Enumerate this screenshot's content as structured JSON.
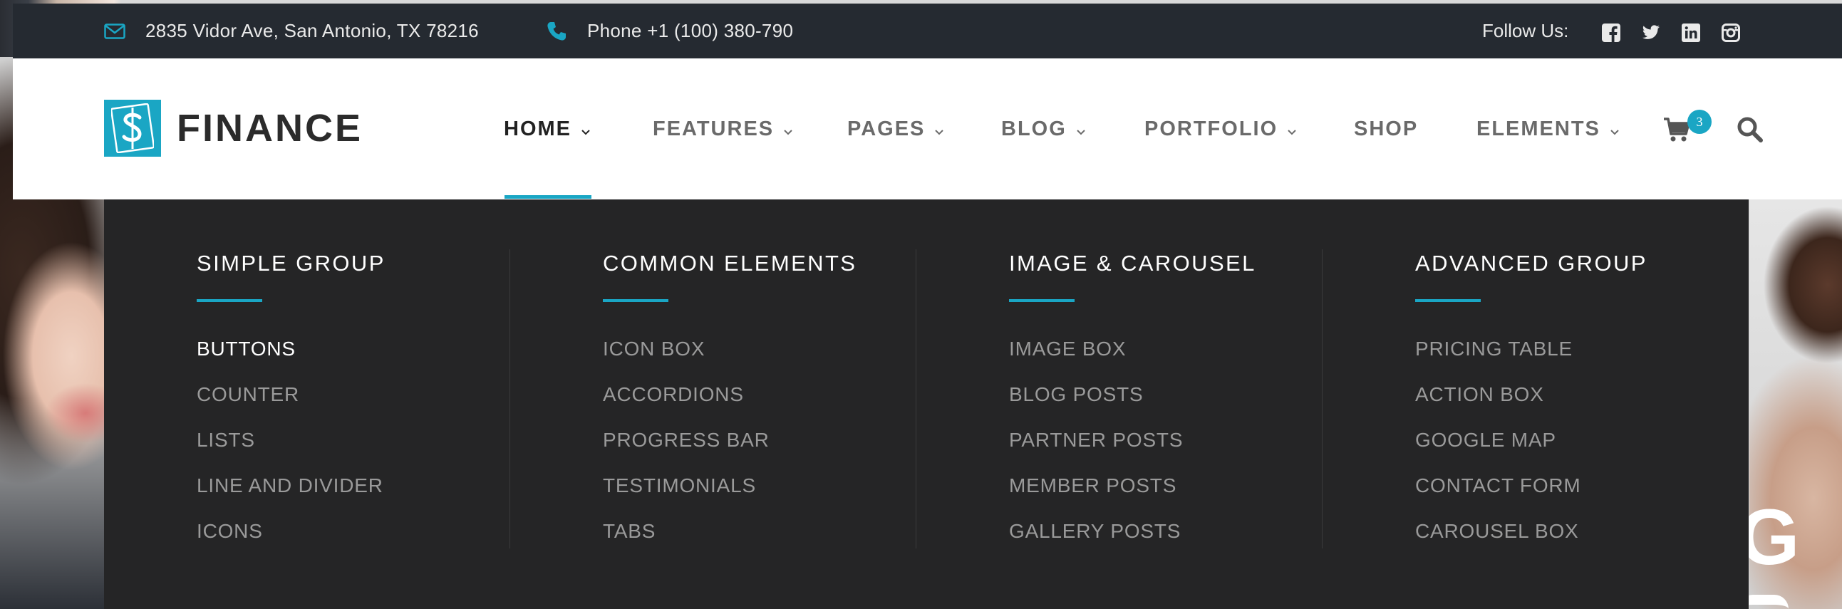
{
  "colors": {
    "accent": "#1aa6c4",
    "topbar_bg": "#252a31",
    "mega_bg": "#252526",
    "text_dark": "#2b2b2b",
    "nav_text": "#6a6a6a"
  },
  "topbar": {
    "address": "2835 Vidor Ave, San Antonio, TX 78216",
    "phone": "Phone +1 (100) 380-790",
    "follow_label": "Follow Us:",
    "social_icons": [
      "facebook-icon",
      "twitter-icon",
      "linkedin-icon",
      "instagram-icon"
    ]
  },
  "header": {
    "logo_text": "FINANCE",
    "logo_icon": "dollar-icon",
    "nav": [
      {
        "label": "HOME",
        "has_dropdown": true,
        "active": true
      },
      {
        "label": "FEATURES",
        "has_dropdown": true
      },
      {
        "label": "PAGES",
        "has_dropdown": true
      },
      {
        "label": "BLOG",
        "has_dropdown": true
      },
      {
        "label": "PORTFOLIO",
        "has_dropdown": true
      },
      {
        "label": "SHOP",
        "has_dropdown": false
      },
      {
        "label": "ELEMENTS",
        "has_dropdown": true
      }
    ],
    "cart_count": "3"
  },
  "mega_menu": {
    "columns": [
      {
        "title": "SIMPLE GROUP",
        "items": [
          "BUTTONS",
          "COUNTER",
          "LISTS",
          "LINE AND DIVIDER",
          "ICONS"
        ],
        "active_item": "BUTTONS"
      },
      {
        "title": "COMMON ELEMENTS",
        "items": [
          "ICON BOX",
          "ACCORDIONS",
          "PROGRESS BAR",
          "TESTIMONIALS",
          "TABS"
        ]
      },
      {
        "title": "IMAGE & CAROUSEL",
        "items": [
          "IMAGE BOX",
          "BLOG POSTS",
          "PARTNER POSTS",
          "MEMBER POSTS",
          "GALLERY POSTS"
        ]
      },
      {
        "title": "ADVANCED GROUP",
        "items": [
          "PRICING TABLE",
          "ACTION BOX",
          "GOOGLE MAP",
          "CONTACT FORM",
          "CAROUSEL BOX"
        ]
      }
    ]
  }
}
